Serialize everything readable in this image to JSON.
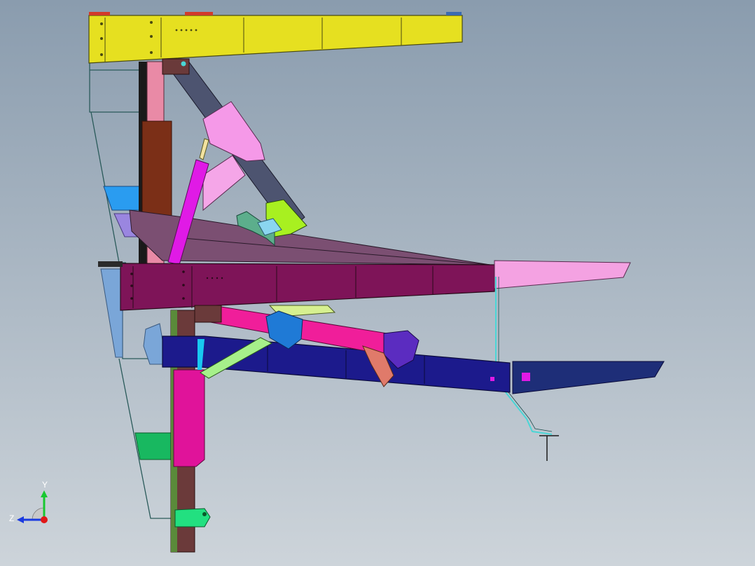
{
  "viewport": {
    "background_top": "#8a9cae",
    "background_bottom": "#cdd4da"
  },
  "model": {
    "parts": [
      {
        "name": "top-beam",
        "color": "#e6e020"
      },
      {
        "name": "main-mast",
        "color": "#e98aa6"
      },
      {
        "name": "mast-clamp",
        "color": "#7b2f17"
      },
      {
        "name": "upper-arm",
        "color": "#4d5470"
      },
      {
        "name": "upper-arm-bracket",
        "color": "#f599e8"
      },
      {
        "name": "hydraulic-cylinder",
        "color": "#e01ae6"
      },
      {
        "name": "cylinder-rod",
        "color": "#f2e2a0"
      },
      {
        "name": "support-strut",
        "color": "#f5a6e8"
      },
      {
        "name": "jaw-bracket",
        "color": "#a8f020"
      },
      {
        "name": "pivot-lever",
        "color": "#5cae8c"
      },
      {
        "name": "raised-boom",
        "color": "#7b4f72"
      },
      {
        "name": "middle-beam",
        "color": "#7e1458"
      },
      {
        "name": "middle-beam-extension",
        "color": "#f4a2e2"
      },
      {
        "name": "lower-arm",
        "color": "#f01e9a"
      },
      {
        "name": "lower-arm-yoke",
        "color": "#1f7ad6"
      },
      {
        "name": "arm-end-bracket",
        "color": "#5b2cc0"
      },
      {
        "name": "lower-beam",
        "color": "#1c1a8c"
      },
      {
        "name": "lower-beam-extension",
        "color": "#1e2e78"
      },
      {
        "name": "diagonal-link",
        "color": "#a6f08a"
      },
      {
        "name": "lower-mast",
        "color": "#6b3a3a"
      },
      {
        "name": "lower-clamp",
        "color": "#e0139a"
      },
      {
        "name": "step-plate-blue",
        "color": "#2a9cf0"
      },
      {
        "name": "step-plate-green",
        "color": "#18b860"
      },
      {
        "name": "foot-bracket",
        "color": "#22e080"
      },
      {
        "name": "ladder-frame",
        "color": "#2a5a5a"
      },
      {
        "name": "hanging-pipe",
        "color": "#4ad6d6"
      }
    ]
  },
  "triad": {
    "labels": {
      "y": "Y",
      "z": "Z"
    },
    "colors": {
      "y": "#18c830",
      "z": "#1a3ae0",
      "x": "#e01818"
    }
  }
}
